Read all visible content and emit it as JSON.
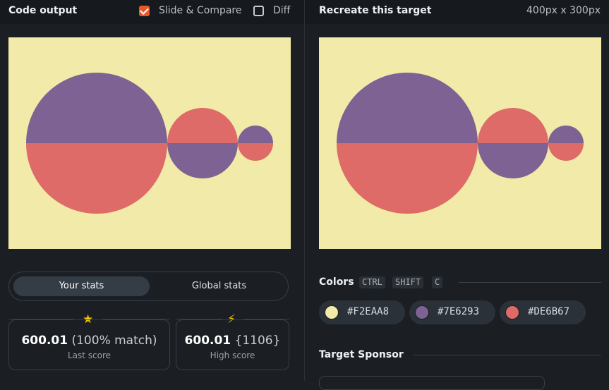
{
  "left_header": {
    "title": "Code output",
    "slide_compare_label": "Slide & Compare",
    "slide_compare_checked": true,
    "diff_label": "Diff",
    "diff_checked": false
  },
  "right_header": {
    "title": "Recreate this target",
    "dimensions": "400px x 300px"
  },
  "canvas_colors": {
    "background": "#F2EAA8",
    "purple": "#7E6293",
    "red": "#DE6B67"
  },
  "stats": {
    "tabs": [
      "Your stats",
      "Global stats"
    ],
    "active_tab": "Your stats",
    "last_score": {
      "value": "600.01",
      "detail": "(100% match)",
      "label": "Last score",
      "icon": "star-icon"
    },
    "high_score": {
      "value": "600.01",
      "detail": "{1106}",
      "label": "High score",
      "icon": "lightning-icon"
    }
  },
  "colors_section": {
    "title": "Colors",
    "shortcut_keys": [
      "CTRL",
      "SHIFT",
      "C"
    ],
    "swatches": [
      {
        "hex": "#F2EAA8",
        "color": "#F2EAA8"
      },
      {
        "hex": "#7E6293",
        "color": "#7E6293"
      },
      {
        "hex": "#DE6B67",
        "color": "#DE6B67"
      }
    ]
  },
  "sponsor_section": {
    "title": "Target Sponsor"
  }
}
